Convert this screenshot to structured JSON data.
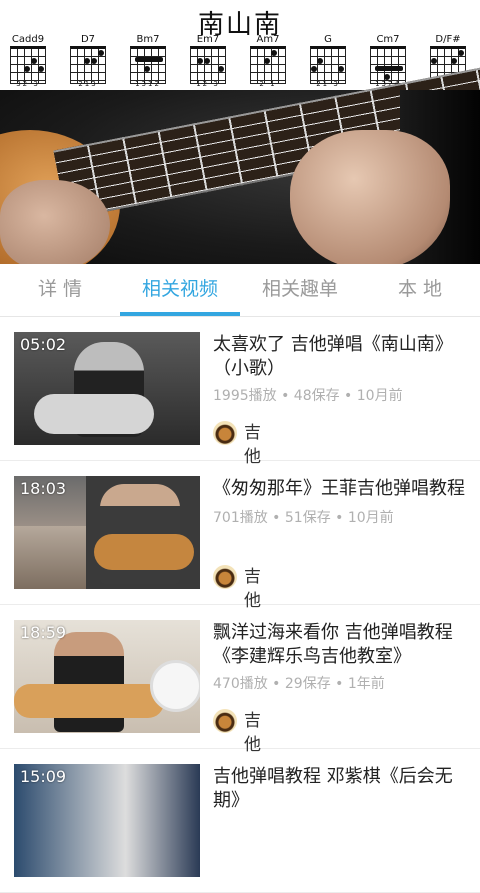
{
  "hero": {
    "song_title": "南山南",
    "chords": [
      {
        "name": "Cadd9",
        "fingers": "32 3"
      },
      {
        "name": "D7",
        "fingers": "213"
      },
      {
        "name": "Bm7",
        "fingers": "1312"
      },
      {
        "name": "Em7",
        "fingers": "12 3"
      },
      {
        "name": "Am7",
        "fingers": "2 1"
      },
      {
        "name": "G",
        "fingers": "21 3"
      },
      {
        "name": "Cm7",
        "fingers": "1324"
      },
      {
        "name": "D/F#",
        "fingers": "243"
      }
    ]
  },
  "tabs": [
    {
      "label": "详 情",
      "active": false
    },
    {
      "label": "相关视频",
      "active": true
    },
    {
      "label": "相关趣单",
      "active": false
    },
    {
      "label": "本 地",
      "active": false
    }
  ],
  "accent_color": "#33a6e0",
  "videos": [
    {
      "duration": "05:02",
      "title": "太喜欢了 吉他弹唱《南山南》（小歌）",
      "meta": "1995播放 • 48保存 • 10月前",
      "author": "吉他"
    },
    {
      "duration": "18:03",
      "title": "《匆匆那年》王菲吉他弹唱教程",
      "meta": "701播放 • 51保存 • 10月前",
      "author": "吉他"
    },
    {
      "duration": "18:59",
      "title": "飘洋过海来看你 吉他弹唱教程《李建辉乐鸟吉他教室》",
      "meta": "470播放 • 29保存 • 1年前",
      "author": "吉他"
    },
    {
      "duration": "15:09",
      "title": "吉他弹唱教程 邓紫棋《后会无期》",
      "meta": "",
      "author": ""
    }
  ]
}
